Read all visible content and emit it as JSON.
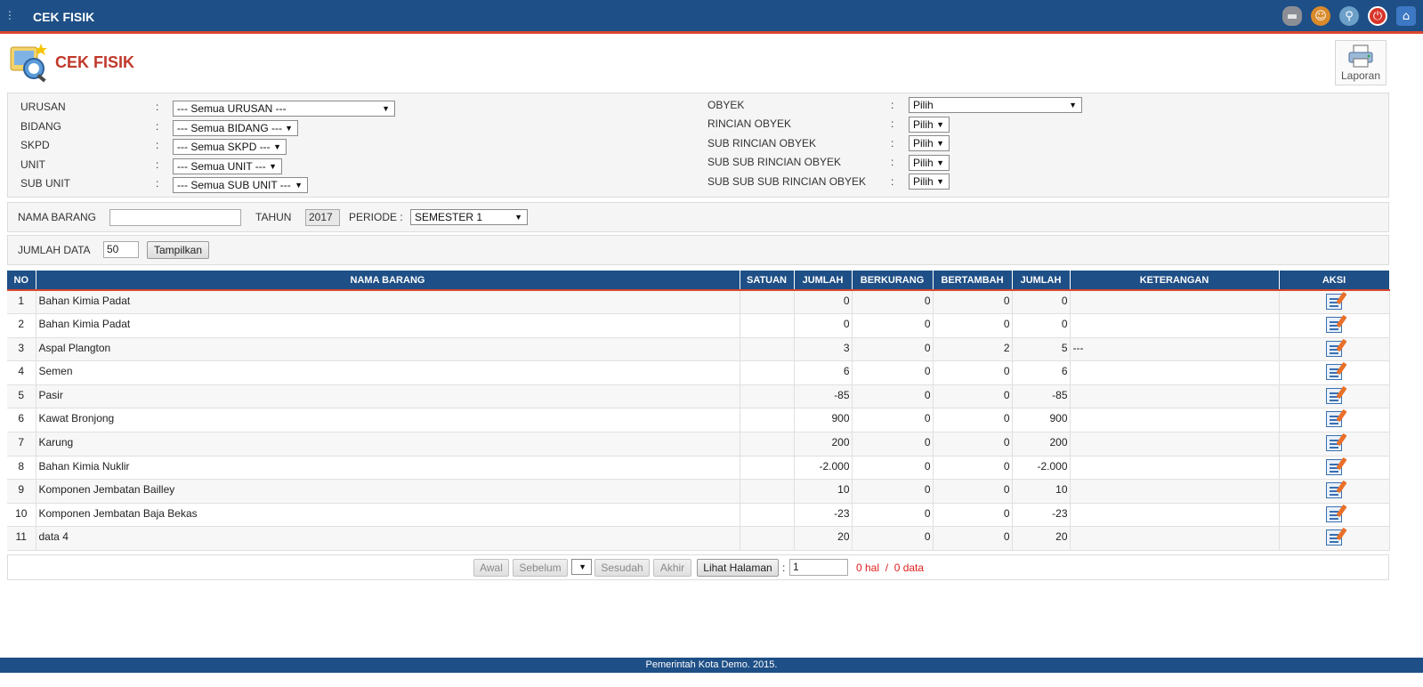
{
  "app": {
    "title": "CEK FISIK",
    "menu_icon": "sidebar-toggle-icon",
    "top_icons": [
      "chat-icon",
      "user-icon",
      "search-icon",
      "power-icon",
      "home-icon"
    ]
  },
  "page": {
    "title": "CEK FISIK",
    "report_label": "Laporan"
  },
  "filters": {
    "left": [
      {
        "label": "URUSAN",
        "value": "--- Semua URUSAN ---"
      },
      {
        "label": "BIDANG",
        "value": "--- Semua BIDANG ---"
      },
      {
        "label": "SKPD",
        "value": "--- Semua SKPD ---"
      },
      {
        "label": "UNIT",
        "value": "--- Semua UNIT ---"
      },
      {
        "label": "SUB UNIT",
        "value": "--- Semua SUB UNIT ---"
      }
    ],
    "right": [
      {
        "label": "OBYEK",
        "value": "Pilih"
      },
      {
        "label": "RINCIAN OBYEK",
        "value": "Pilih"
      },
      {
        "label": "SUB RINCIAN OBYEK",
        "value": "Pilih"
      },
      {
        "label": "SUB SUB RINCIAN OBYEK",
        "value": "Pilih"
      },
      {
        "label": "SUB SUB SUB RINCIAN OBYEK",
        "value": "Pilih"
      }
    ],
    "colon": ":"
  },
  "search": {
    "nama_barang_label": "NAMA BARANG",
    "nama_barang_value": "",
    "tahun_label": "TAHUN",
    "tahun_value": "2017",
    "periode_label": "PERIODE :",
    "periode_value": "SEMESTER 1"
  },
  "count": {
    "label": "JUMLAH DATA",
    "value": "50",
    "button": "Tampilkan"
  },
  "table": {
    "headers": [
      "NO",
      "NAMA BARANG",
      "SATUAN",
      "JUMLAH",
      "BERKURANG",
      "BERTAMBAH",
      "JUMLAH",
      "KETERANGAN",
      "AKSI"
    ],
    "rows": [
      {
        "no": "1",
        "nama": "Bahan Kimia Padat",
        "satuan": "",
        "jumlah": "0",
        "berkurang": "0",
        "bertambah": "0",
        "jumlah2": "0",
        "ket": ""
      },
      {
        "no": "2",
        "nama": "Bahan Kimia Padat",
        "satuan": "",
        "jumlah": "0",
        "berkurang": "0",
        "bertambah": "0",
        "jumlah2": "0",
        "ket": ""
      },
      {
        "no": "3",
        "nama": "Aspal Plangton",
        "satuan": "",
        "jumlah": "3",
        "berkurang": "0",
        "bertambah": "2",
        "jumlah2": "5",
        "ket": "---"
      },
      {
        "no": "4",
        "nama": "Semen",
        "satuan": "",
        "jumlah": "6",
        "berkurang": "0",
        "bertambah": "0",
        "jumlah2": "6",
        "ket": ""
      },
      {
        "no": "5",
        "nama": "Pasir",
        "satuan": "",
        "jumlah": "-85",
        "berkurang": "0",
        "bertambah": "0",
        "jumlah2": "-85",
        "ket": ""
      },
      {
        "no": "6",
        "nama": "Kawat Bronjong",
        "satuan": "",
        "jumlah": "900",
        "berkurang": "0",
        "bertambah": "0",
        "jumlah2": "900",
        "ket": ""
      },
      {
        "no": "7",
        "nama": "Karung",
        "satuan": "",
        "jumlah": "200",
        "berkurang": "0",
        "bertambah": "0",
        "jumlah2": "200",
        "ket": ""
      },
      {
        "no": "8",
        "nama": "Bahan Kimia Nuklir",
        "satuan": "",
        "jumlah": "-2.000",
        "berkurang": "0",
        "bertambah": "0",
        "jumlah2": "-2.000",
        "ket": ""
      },
      {
        "no": "9",
        "nama": "Komponen Jembatan Bailley",
        "satuan": "",
        "jumlah": "10",
        "berkurang": "0",
        "bertambah": "0",
        "jumlah2": "10",
        "ket": ""
      },
      {
        "no": "10",
        "nama": "Komponen Jembatan Baja Bekas",
        "satuan": "",
        "jumlah": "-23",
        "berkurang": "0",
        "bertambah": "0",
        "jumlah2": "-23",
        "ket": ""
      },
      {
        "no": "11",
        "nama": "data 4",
        "satuan": "",
        "jumlah": "20",
        "berkurang": "0",
        "bertambah": "0",
        "jumlah2": "20",
        "ket": ""
      }
    ]
  },
  "pager": {
    "first": "Awal",
    "prev": "Sebelum",
    "next": "Sesudah",
    "last": "Akhir",
    "view": "Lihat Halaman",
    "colon": ":",
    "page_value": "1",
    "info": "0 hal  /  0 data"
  },
  "footer": {
    "text": "Pemerintah Kota Demo. 2015."
  },
  "colors": {
    "header_blue": "#1e4f86",
    "accent_red": "#d9462e",
    "title_red": "#c0392b"
  }
}
